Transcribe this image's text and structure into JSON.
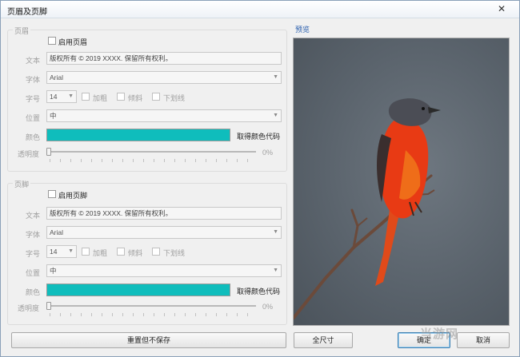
{
  "window": {
    "title": "页眉及页脚",
    "close_glyph": "✕"
  },
  "header_group": {
    "title": "页眉",
    "enable_label": "启用页眉",
    "text_label": "文本",
    "text_value": "版权所有 © 2019 XXXX. 保留所有权利。",
    "font_label": "字体",
    "font_value": "Arial",
    "size_label": "字号",
    "size_value": "14",
    "bold_label": "加粗",
    "italic_label": "倾斜",
    "underline_label": "下划线",
    "position_label": "位置",
    "position_value": "中",
    "color_label": "颜色",
    "color_value": "#0fbdbc",
    "get_color_label": "取得颜色代码",
    "opacity_label": "透明度",
    "opacity_value": "0%",
    "opacity_fraction": 0
  },
  "footer_group": {
    "title": "页脚",
    "enable_label": "启用页脚",
    "text_label": "文本",
    "text_value": "版权所有 © 2019 XXXX. 保留所有权利。",
    "font_label": "字体",
    "font_value": "Arial",
    "size_label": "字号",
    "size_value": "14",
    "bold_label": "加粗",
    "italic_label": "倾斜",
    "underline_label": "下划线",
    "position_label": "位置",
    "position_value": "中",
    "color_label": "颜色",
    "color_value": "#0fbdbc",
    "get_color_label": "取得颜色代码",
    "opacity_label": "透明度",
    "opacity_value": "0%",
    "opacity_fraction": 0
  },
  "preview": {
    "label": "预览"
  },
  "buttons": {
    "reset": "重置但不保存",
    "full_size": "全尺寸",
    "ok": "确定",
    "cancel": "取消"
  },
  "watermark": "当游网"
}
